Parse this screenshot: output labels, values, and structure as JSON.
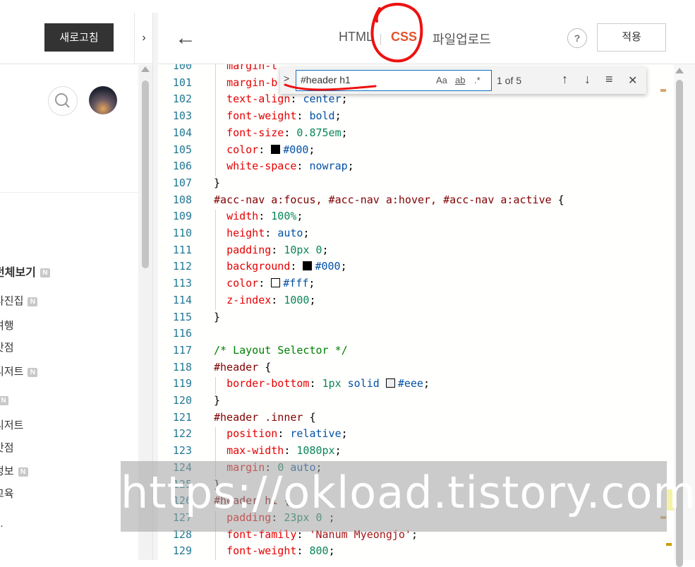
{
  "left": {
    "refresh_label": "새로고침",
    "toggle_glyph": "›",
    "categories": [
      {
        "label": "전체보기",
        "badge": "N",
        "main": true
      },
      {
        "label": "사진집",
        "badge": "N"
      },
      {
        "label": "여행"
      },
      {
        "label": "맛점"
      },
      {
        "label": "디저트",
        "badge": "N"
      },
      {
        "label": "",
        "badge": "N"
      },
      {
        "label": "디저트"
      },
      {
        "label": "맛점"
      },
      {
        "label": "정보",
        "badge": "N"
      },
      {
        "label": "교육"
      },
      {
        "label": "..."
      }
    ]
  },
  "header": {
    "back_glyph": "←",
    "tabs": {
      "html": "HTML",
      "css": "CSS",
      "upload": "파일업로드"
    },
    "help": "?",
    "apply": "적용"
  },
  "find": {
    "toggle": ">",
    "query": "#header h1",
    "opt_case": "Aa",
    "opt_word": "ab",
    "opt_regex": ".*",
    "count": "1 of 5",
    "prev": "↑",
    "next": "↓",
    "sel": "≡",
    "close": "✕"
  },
  "code": {
    "lines": [
      {
        "n": "100",
        "html": "  <span class='prop'>margin-t</span>"
      },
      {
        "n": "101",
        "html": "  <span class='prop'>margin-b</span>"
      },
      {
        "n": "102",
        "html": "  <span class='prop'>text-align</span><span class='pun'>:</span> <span class='val'>center</span><span class='pun'>;</span>"
      },
      {
        "n": "103",
        "html": "  <span class='prop'>font-weight</span><span class='pun'>:</span> <span class='val'>bold</span><span class='pun'>;</span>"
      },
      {
        "n": "104",
        "html": "  <span class='prop'>font-size</span><span class='pun'>:</span> <span class='num'>0.875em</span><span class='pun'>;</span>"
      },
      {
        "n": "105",
        "html": "  <span class='prop'>color</span><span class='pun'>:</span> <span class='swatch' style='background:#000'></span><span class='val'>#000</span><span class='pun'>;</span>"
      },
      {
        "n": "106",
        "html": "  <span class='prop'>white-space</span><span class='pun'>:</span> <span class='val'>nowrap</span><span class='pun'>;</span>"
      },
      {
        "n": "107",
        "html": "<span class='pun'>}</span>"
      },
      {
        "n": "108",
        "html": "<span class='sel'>#acc-nav a:focus, #acc-nav a:hover, #acc-nav a:active</span> <span class='pun'>{</span>"
      },
      {
        "n": "109",
        "html": "  <span class='prop'>width</span><span class='pun'>:</span> <span class='num'>100%</span><span class='pun'>;</span>"
      },
      {
        "n": "110",
        "html": "  <span class='prop'>height</span><span class='pun'>:</span> <span class='val'>auto</span><span class='pun'>;</span>"
      },
      {
        "n": "111",
        "html": "  <span class='prop'>padding</span><span class='pun'>:</span> <span class='num'>10px 0</span><span class='pun'>;</span>"
      },
      {
        "n": "112",
        "html": "  <span class='prop'>background</span><span class='pun'>:</span> <span class='swatch' style='background:#000'></span><span class='val'>#000</span><span class='pun'>;</span>"
      },
      {
        "n": "113",
        "html": "  <span class='prop'>color</span><span class='pun'>:</span> <span class='swatch' style='background:#fff'></span><span class='val'>#fff</span><span class='pun'>;</span>"
      },
      {
        "n": "114",
        "html": "  <span class='prop'>z-index</span><span class='pun'>:</span> <span class='num'>1000</span><span class='pun'>;</span>"
      },
      {
        "n": "115",
        "html": "<span class='pun'>}</span>"
      },
      {
        "n": "116",
        "html": ""
      },
      {
        "n": "117",
        "html": "<span class='cmt'>/* Layout Selector */</span>"
      },
      {
        "n": "118",
        "html": "<span class='sel'>#header</span> <span class='pun'>{</span>"
      },
      {
        "n": "119",
        "html": "  <span class='prop'>border-bottom</span><span class='pun'>:</span> <span class='num'>1px</span> <span class='val'>solid</span> <span class='swatch' style='background:#eee'></span><span class='val'>#eee</span><span class='pun'>;</span>"
      },
      {
        "n": "120",
        "html": "<span class='pun'>}</span>"
      },
      {
        "n": "121",
        "html": "<span class='sel'>#header .inner</span> <span class='pun'>{</span>"
      },
      {
        "n": "122",
        "html": "  <span class='prop'>position</span><span class='pun'>:</span> <span class='val'>relative</span><span class='pun'>;</span>"
      },
      {
        "n": "123",
        "html": "  <span class='prop'>max-width</span><span class='pun'>:</span> <span class='num'>1080px</span><span class='pun'>;</span>"
      },
      {
        "n": "124",
        "html": "  <span class='prop'>margin</span><span class='pun'>:</span> <span class='num'>0</span> <span class='val'>auto</span><span class='pun'>;</span>"
      },
      {
        "n": "125",
        "html": "<span class='pun'>}</span>"
      },
      {
        "n": "126",
        "html": "<span class='sel'>#header h1</span> <span class='pun'>{</span>"
      },
      {
        "n": "127",
        "html": "  <span class='prop'>padding</span><span class='pun'>:</span> <span class='num'>23px 0</span> <span class='pun'>;</span>"
      },
      {
        "n": "128",
        "html": "  <span class='prop'>font-family</span><span class='pun'>:</span> <span class='str'>'Nanum Myeongjo'</span><span class='pun'>;</span>"
      },
      {
        "n": "129",
        "html": "  <span class='prop'>font-weight</span><span class='pun'>:</span> <span class='num'>800</span><span class='pun'>;</span>"
      }
    ]
  },
  "watermark": "https://okload.tistory.com"
}
